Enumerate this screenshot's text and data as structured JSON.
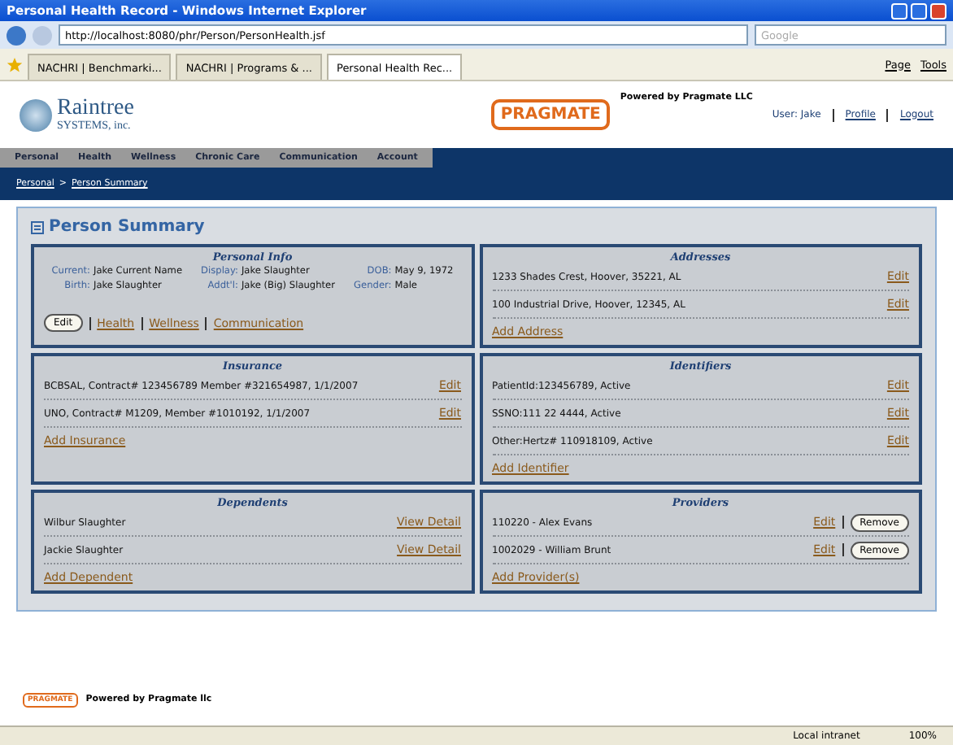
{
  "window": {
    "title": "Personal Health Record - Windows Internet Explorer"
  },
  "browser": {
    "address": "http://localhost:8080/phr/Person/PersonHealth.jsf",
    "search_placeholder": "Google",
    "tabs": [
      {
        "label": "NACHRI | Benchmarki...",
        "selected": false
      },
      {
        "label": "NACHRI | Programs & ...",
        "selected": false
      },
      {
        "label": "Personal Health Rec...",
        "selected": true
      }
    ],
    "tools": [
      "Page",
      "Tools"
    ]
  },
  "header": {
    "logo_name": "Raintree",
    "logo_sub": "SYSTEMS, inc.",
    "brand": "PRAGMATE",
    "powered": "Powered by Pragmate LLC",
    "user": "User: Jake",
    "links": [
      "Profile",
      "Logout"
    ]
  },
  "nav": [
    {
      "label": "Personal",
      "selected": false
    },
    {
      "label": "Health",
      "selected": false
    },
    {
      "label": "Wellness",
      "selected": false
    },
    {
      "label": "Chronic Care",
      "selected": false
    },
    {
      "label": "Communication",
      "selected": false
    },
    {
      "label": "Account",
      "selected": false
    }
  ],
  "breadcrumb": {
    "separator": ">",
    "items": [
      "Personal",
      "Person Summary"
    ]
  },
  "page_title": "Person Summary",
  "sections": [
    {
      "kind": "info",
      "title": "Personal Info",
      "fields": [
        {
          "label": "Current:",
          "value": "Jake Current Name"
        },
        {
          "label": "Display:",
          "value": "Jake Slaughter"
        },
        {
          "label": "DOB:",
          "value": "May 9, 1972"
        },
        {
          "label": "Birth:",
          "value": "Jake Slaughter"
        },
        {
          "label": "Addt'l:",
          "value": "Jake (Big) Slaughter"
        },
        {
          "label": "Gender:",
          "value": "Male"
        }
      ],
      "button": "Edit",
      "links": [
        "Health",
        "Wellness",
        "Communication"
      ]
    },
    {
      "kind": "list",
      "title": "Addresses",
      "rows": [
        {
          "text": "1233 Shades Crest, Hoover, 35221, AL",
          "action": "Edit"
        },
        {
          "text": "100 Industrial Drive, Hoover, 12345, AL",
          "action": "Edit"
        }
      ],
      "add": "Add Address"
    },
    {
      "kind": "list",
      "title": "Insurance",
      "rows": [
        {
          "text": "BCBSAL, Contract# 123456789 Member #321654987, 1/1/2007",
          "action": "Edit"
        },
        {
          "text": "UNO, Contract# M1209, Member #1010192, 1/1/2007",
          "action": "Edit"
        }
      ],
      "add": "Add Insurance"
    },
    {
      "kind": "list",
      "title": "Identifiers",
      "rows": [
        {
          "text": "PatientId:123456789, Active",
          "action": "Edit"
        },
        {
          "text": "SSNO:111 22 4444, Active",
          "action": "Edit"
        },
        {
          "text": "Other:Hertz# 110918109, Active",
          "action": "Edit"
        }
      ],
      "add": "Add Identifier"
    },
    {
      "kind": "list",
      "title": "Dependents",
      "rows": [
        {
          "text": "Wilbur Slaughter",
          "action": "View Detail"
        },
        {
          "text": "Jackie Slaughter",
          "action": "View Detail"
        }
      ],
      "add": "Add Dependent"
    },
    {
      "kind": "list",
      "title": "Providers",
      "rows": [
        {
          "text": "110220 - Alex Evans",
          "action": "Edit",
          "button": "Remove"
        },
        {
          "text": "1002029 - William Brunt",
          "action": "Edit",
          "button": "Remove"
        }
      ],
      "add": "Add Provider(s)"
    }
  ],
  "footer": {
    "brand": "PRAGMATE",
    "text": "Powered by Pragmate llc"
  },
  "status_bar": {
    "zone": "Local intranet",
    "zoom": "100%"
  }
}
